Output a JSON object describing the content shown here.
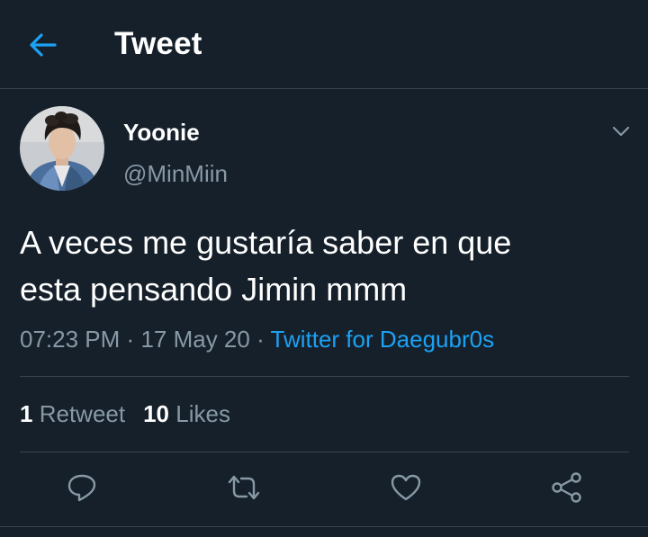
{
  "header": {
    "title": "Tweet",
    "back_icon": "arrow-left-icon"
  },
  "author": {
    "display_name": "Yoonie",
    "username": "@MinMiin"
  },
  "tweet": {
    "text_line1": "A veces me gustaría saber en que",
    "text_line2": "esta pensando Jimin mmm",
    "time": "07:23 PM",
    "date": "17 May 20",
    "separator": "·",
    "source": "Twitter for Daegubr0s"
  },
  "stats": {
    "retweets_count": "1",
    "retweets_label": "Retweet",
    "likes_count": "10",
    "likes_label": "Likes"
  },
  "actions": [
    "reply-icon",
    "retweet-icon",
    "like-icon",
    "share-icon"
  ],
  "colors": {
    "background": "#15202b",
    "accent": "#1da1f2",
    "muted_text": "#8899a6",
    "divider": "#38444d"
  }
}
